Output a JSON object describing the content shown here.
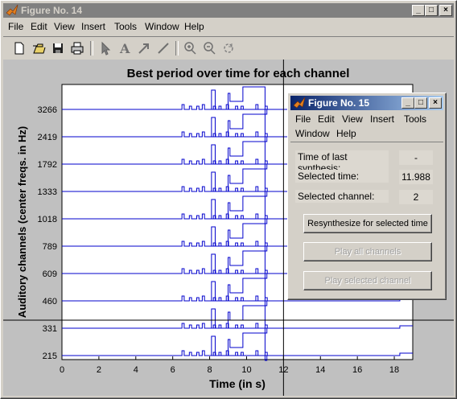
{
  "main_window": {
    "title": "Figure No. 14",
    "menus": [
      "File",
      "Edit",
      "View",
      "Insert",
      "Tools",
      "Window",
      "Help"
    ],
    "toolbar_icons": [
      "new-file-icon",
      "open-folder-icon",
      "save-icon",
      "print-icon",
      "select-arrow-icon",
      "text-insert-icon",
      "arrow-insert-icon",
      "line-insert-icon",
      "zoom-in-icon",
      "zoom-out-icon",
      "rotate-icon"
    ]
  },
  "chart_data": {
    "type": "line",
    "title": "Best period over time for each channel",
    "xlabel": "Time (in s)",
    "ylabel": "Auditory channels (center freqs. in Hz)",
    "x_ticks": [
      "0",
      "2",
      "4",
      "6",
      "8",
      "10",
      "12",
      "14",
      "16",
      "18"
    ],
    "xlim": [
      0,
      19
    ],
    "channels": [
      "3266",
      "2419",
      "1792",
      "1333",
      "1018",
      "789",
      "609",
      "460",
      "331",
      "215"
    ],
    "cursor": {
      "time": 12.0,
      "channel_index": 8
    },
    "line_color": "#0000cc"
  },
  "popup": {
    "title": "Figure No. 15",
    "menus_row1": [
      "File",
      "Edit",
      "View",
      "Insert",
      "Tools"
    ],
    "menus_row2": [
      "Window",
      "Help"
    ],
    "fields": [
      {
        "label": "Time of last synthesis:",
        "value": "-"
      },
      {
        "label": "Selected time:",
        "value": "11.988"
      },
      {
        "label": "Selected channel:",
        "value": "2"
      }
    ],
    "buttons": [
      {
        "label": "Resynthesize for selected time",
        "enabled": true
      },
      {
        "label": "Play all channels",
        "enabled": false
      },
      {
        "label": "Play selected channel",
        "enabled": false
      }
    ]
  }
}
